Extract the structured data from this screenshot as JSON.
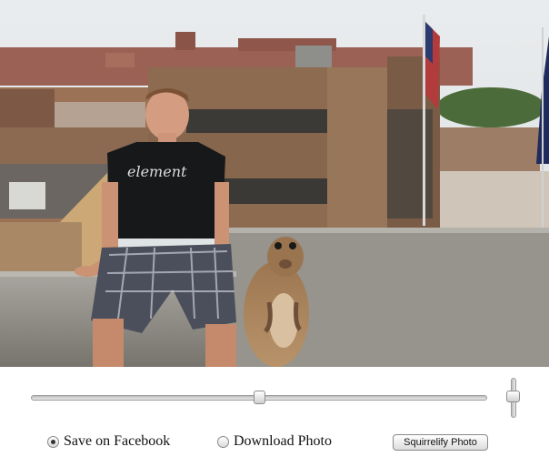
{
  "photo": {
    "subject": "person-and-squirrel-photo"
  },
  "controls": {
    "horizontal_slider": {
      "value_percent": 50
    },
    "vertical_slider": {
      "value_percent": 45
    },
    "options": [
      {
        "label": "Save on Facebook",
        "selected": true
      },
      {
        "label": "Download Photo",
        "selected": false
      }
    ],
    "submit_label": "Squirrelify Photo"
  }
}
